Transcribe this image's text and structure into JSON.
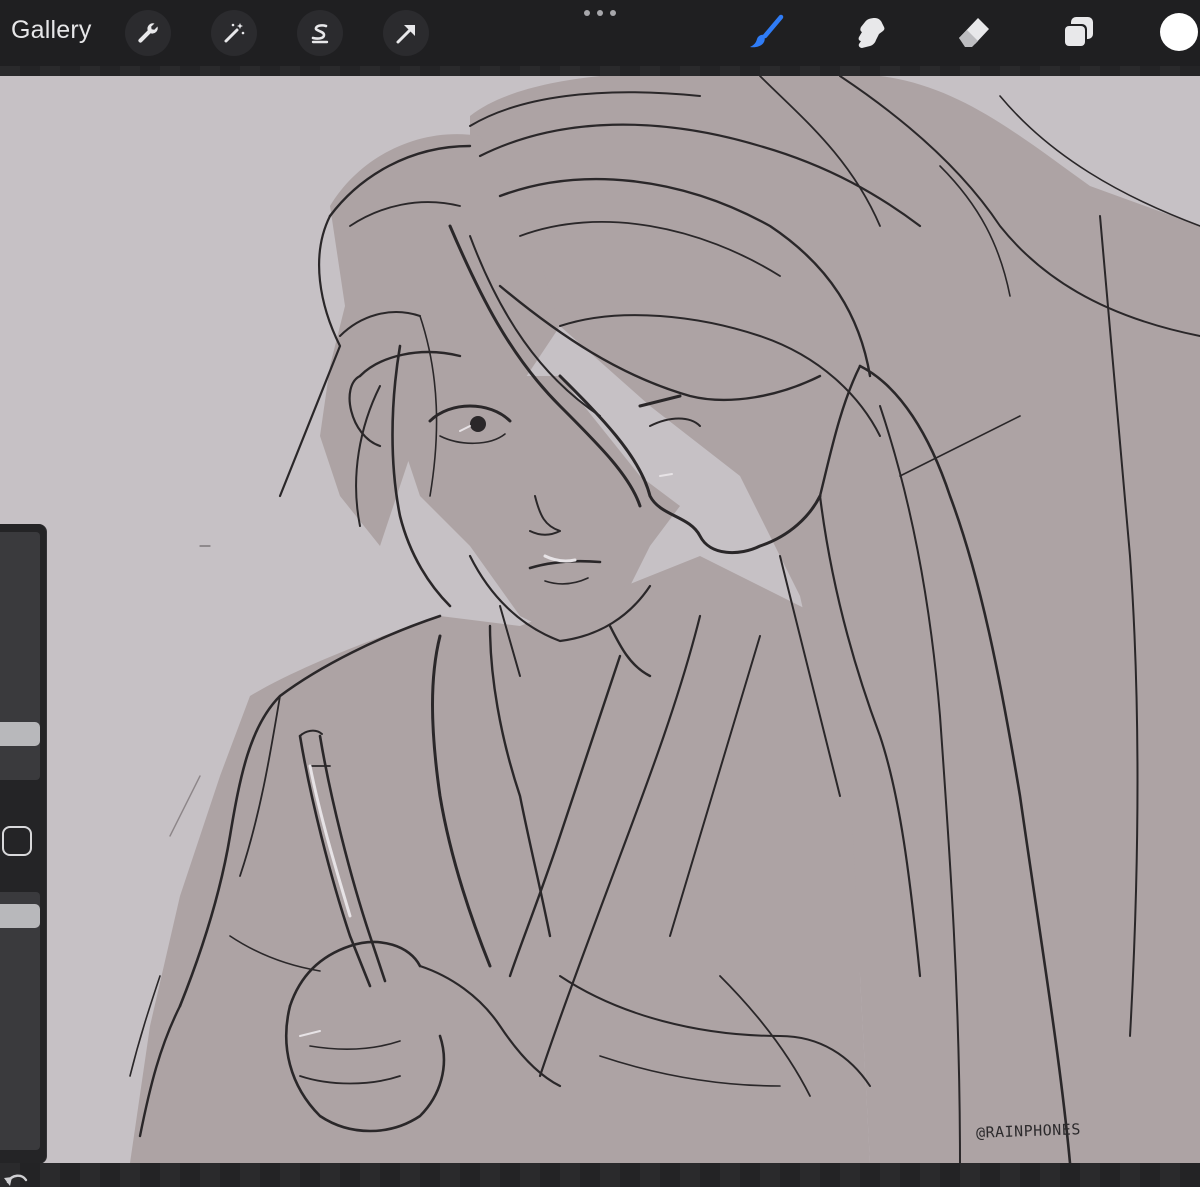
{
  "toolbar": {
    "gallery_label": "Gallery",
    "left_tools": [
      "wrench-icon",
      "magic-wand-icon",
      "selection-icon",
      "transform-arrow-icon"
    ],
    "right_tools": [
      "brush-icon",
      "smudge-icon",
      "eraser-icon",
      "layers-icon"
    ],
    "active_tool": "brush",
    "active_color": "#ffffff",
    "accent_color": "#2f7cf6"
  },
  "canvas": {
    "background_color": "#c6c1c5",
    "fill_color": "#ada3a4",
    "line_color": "#2a2729",
    "signature": "@RAINPHONES"
  },
  "sidebar": {
    "brush_size_fraction": 0.75,
    "opacity_fraction": 0.4
  }
}
